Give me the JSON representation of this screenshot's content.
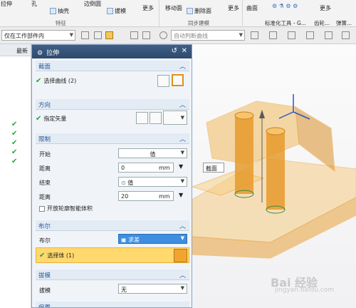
{
  "ribbon": {
    "items": [
      "拉伸",
      "孔",
      "抽壳",
      "边倒圆",
      "拔模",
      "更多",
      "移动面",
      "删除面",
      "更多",
      "曲面",
      "更多",
      "标准化工具 - G...",
      "齿轮...",
      "弹簧..."
    ],
    "groups": [
      "特征",
      "同步建模"
    ]
  },
  "selection_bar": {
    "scope": "仅在工作部件内",
    "curve_rule": "自动判断曲线"
  },
  "left_pane": {
    "column_header": "最新"
  },
  "dialog": {
    "title": "拉伸",
    "sections": {
      "section": "截面",
      "direction": "方向",
      "limits": "限制",
      "boolean": "布尔",
      "draft": "拔模",
      "offset": "偏置"
    },
    "select_curve": "选择曲线 (2)",
    "specify_vector": "指定矢量",
    "start_label": "开始",
    "start_value": "值",
    "distance_label": "距离",
    "start_distance": "0",
    "end_label": "结束",
    "end_value": "值",
    "end_distance": "20",
    "unit": "mm",
    "open_profile": "开放轮廓智能体积",
    "boolean_label": "布尔",
    "boolean_value": "求差",
    "select_body": "选择体 (1)",
    "draft_label": "拔模",
    "draft_value": "无"
  },
  "viewport": {
    "section_label": "截面",
    "watermark_main": "Bai 经验",
    "watermark_sub": "jingyan.baidu.com"
  },
  "colors": {
    "model": "#e8a33a",
    "model_dark": "#c9801c",
    "highlight": "#ffd86e",
    "check": "#27a040",
    "title_bar": "#3e5f86"
  }
}
